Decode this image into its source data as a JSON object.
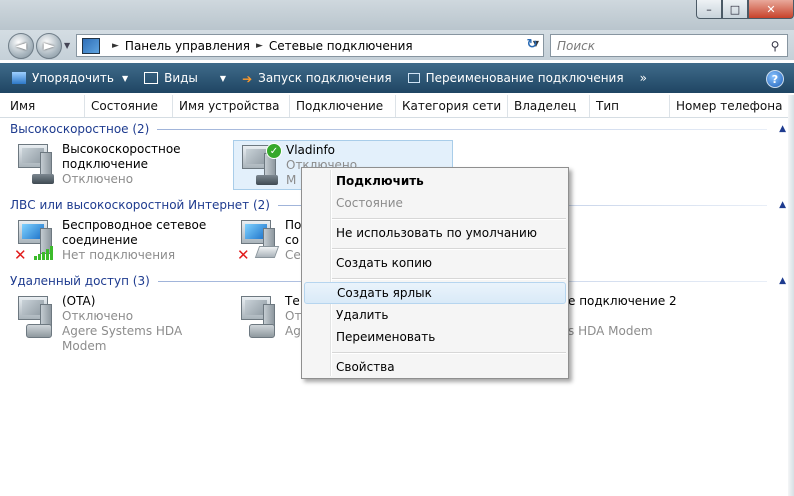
{
  "window": {
    "minimize": "–",
    "maximize": "□",
    "close": "✕"
  },
  "nav": {
    "back": "◄",
    "forward": "►",
    "refresh": "↻"
  },
  "address": {
    "crumbs": [
      "Панель управления",
      "Сетевые подключения"
    ]
  },
  "search": {
    "placeholder": "Поиск"
  },
  "toolbar": {
    "organize": "Упорядочить",
    "views": "Виды",
    "start_connection": "Запуск подключения",
    "rename_connection": "Переименование подключения",
    "more": "»",
    "help": "?"
  },
  "columns": [
    "Имя",
    "Состояние",
    "Имя устройства",
    "Подключение",
    "Категория сети",
    "Владелец",
    "Тип",
    "Номер телефона"
  ],
  "groups": [
    {
      "title": "Высокоскоростное (2)",
      "items": [
        {
          "name1": "Высокоскоростное",
          "name2": "подключение",
          "status": "Отключено"
        },
        {
          "name1": "Vladinfo",
          "status": "Отключено",
          "device": "M"
        }
      ]
    },
    {
      "title": "ЛВС или высокоскоростной Интернет (2)",
      "items": [
        {
          "name1": "Беспроводное сетевое",
          "name2": "соединение",
          "status": "Нет подключения"
        },
        {
          "name1": "По",
          "name2": "со",
          "status": "Се"
        }
      ]
    },
    {
      "title": "Удаленный доступ (3)",
      "items": [
        {
          "name1": "(OTA)",
          "status": "Отключено",
          "device": "Agere Systems HDA Modem"
        },
        {
          "name1": "Те",
          "status": "От",
          "device": "Ag"
        },
        {
          "name1": "е подключение 2",
          "device": "s HDA Modem"
        }
      ]
    }
  ],
  "context_menu": {
    "items": [
      "Подключить",
      "Состояние",
      "Не использовать по умолчанию",
      "Создать копию",
      "Создать ярлык",
      "Удалить",
      "Переименовать",
      "Свойства"
    ]
  }
}
